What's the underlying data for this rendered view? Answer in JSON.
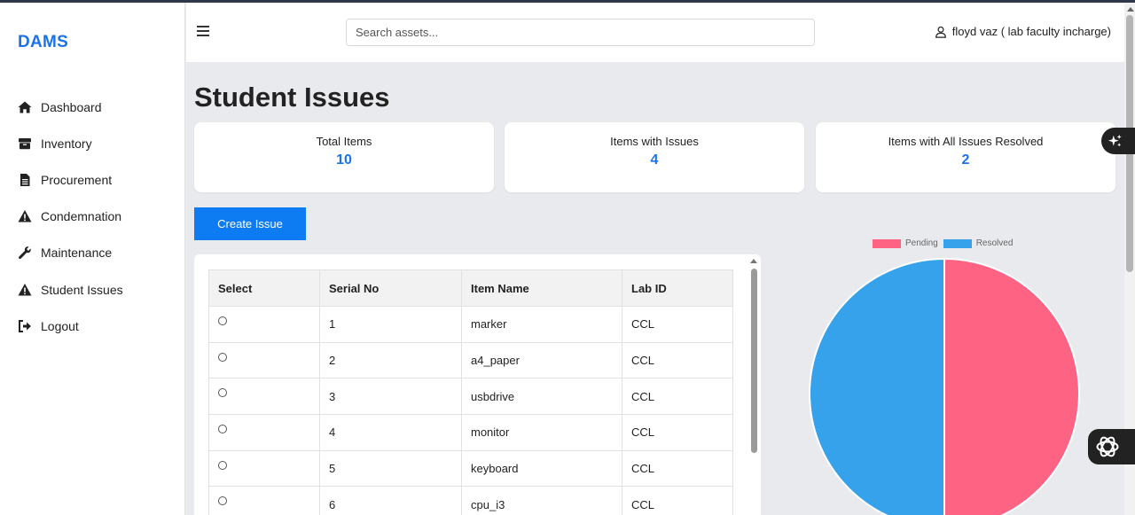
{
  "brand": "DAMS",
  "sidebar": {
    "items": [
      {
        "label": "Dashboard",
        "icon": "home-icon"
      },
      {
        "label": "Inventory",
        "icon": "box-icon"
      },
      {
        "label": "Procurement",
        "icon": "file-icon"
      },
      {
        "label": "Condemnation",
        "icon": "warning-icon"
      },
      {
        "label": "Maintenance",
        "icon": "wrench-icon"
      },
      {
        "label": "Student Issues",
        "icon": "warning-icon"
      },
      {
        "label": "Logout",
        "icon": "logout-icon"
      }
    ]
  },
  "header": {
    "search_placeholder": "Search assets...",
    "user": "floyd vaz ( lab faculty incharge)"
  },
  "page": {
    "title": "Student Issues",
    "create_button": "Create Issue"
  },
  "stats": [
    {
      "label": "Total Items",
      "value": "10"
    },
    {
      "label": "Items with Issues",
      "value": "4"
    },
    {
      "label": "Items with All Issues Resolved",
      "value": "2"
    }
  ],
  "table": {
    "headers": [
      "Select",
      "Serial No",
      "Item Name",
      "Lab ID"
    ],
    "rows": [
      {
        "serial": "1",
        "item": "marker",
        "lab": "CCL"
      },
      {
        "serial": "2",
        "item": "a4_paper",
        "lab": "CCL"
      },
      {
        "serial": "3",
        "item": "usbdrive",
        "lab": "CCL"
      },
      {
        "serial": "4",
        "item": "monitor",
        "lab": "CCL"
      },
      {
        "serial": "5",
        "item": "keyboard",
        "lab": "CCL"
      },
      {
        "serial": "6",
        "item": "cpu_i3",
        "lab": "CCL"
      }
    ]
  },
  "chart_data": {
    "type": "pie",
    "categories": [
      "Pending",
      "Resolved"
    ],
    "values": [
      2,
      2
    ],
    "colors": [
      "#ff6384",
      "#36a2eb"
    ],
    "legend": "top"
  },
  "colors": {
    "accent": "#1a73e8",
    "button": "#0d7cf2"
  }
}
